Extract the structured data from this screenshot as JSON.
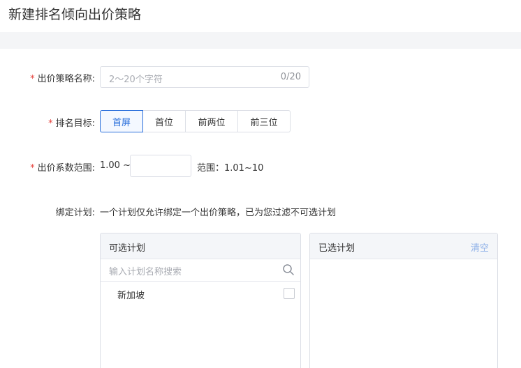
{
  "page": {
    "title": "新建排名倾向出价策略"
  },
  "form": {
    "name": {
      "label": "出价策略名称:",
      "placeholder": "2～20个字符",
      "counter": "0/20"
    },
    "rank_target": {
      "label": "排名目标:",
      "options": [
        "首屏",
        "首位",
        "前两位",
        "前三位"
      ],
      "selected": "首屏"
    },
    "coefficient": {
      "label": "出价系数范围:",
      "prefix": "1.00 ~",
      "value": "",
      "range_text": "范围：1.01~10"
    },
    "bind_plan": {
      "label": "绑定计划:",
      "note": "一个计划仅允许绑定一个出价策略，已为您过滤不可选计划"
    }
  },
  "panels": {
    "available": {
      "title": "可选计划",
      "search_placeholder": "输入计划名称搜索",
      "items": [
        {
          "label": "新加坡",
          "checked": false
        }
      ]
    },
    "selected": {
      "title": "已选计划",
      "clear_label": "清空",
      "items": []
    }
  },
  "colors": {
    "accent": "#2a6fdb",
    "required": "#e5403a",
    "clear_link": "#8fb1e8",
    "band": "#f4f5f7"
  }
}
